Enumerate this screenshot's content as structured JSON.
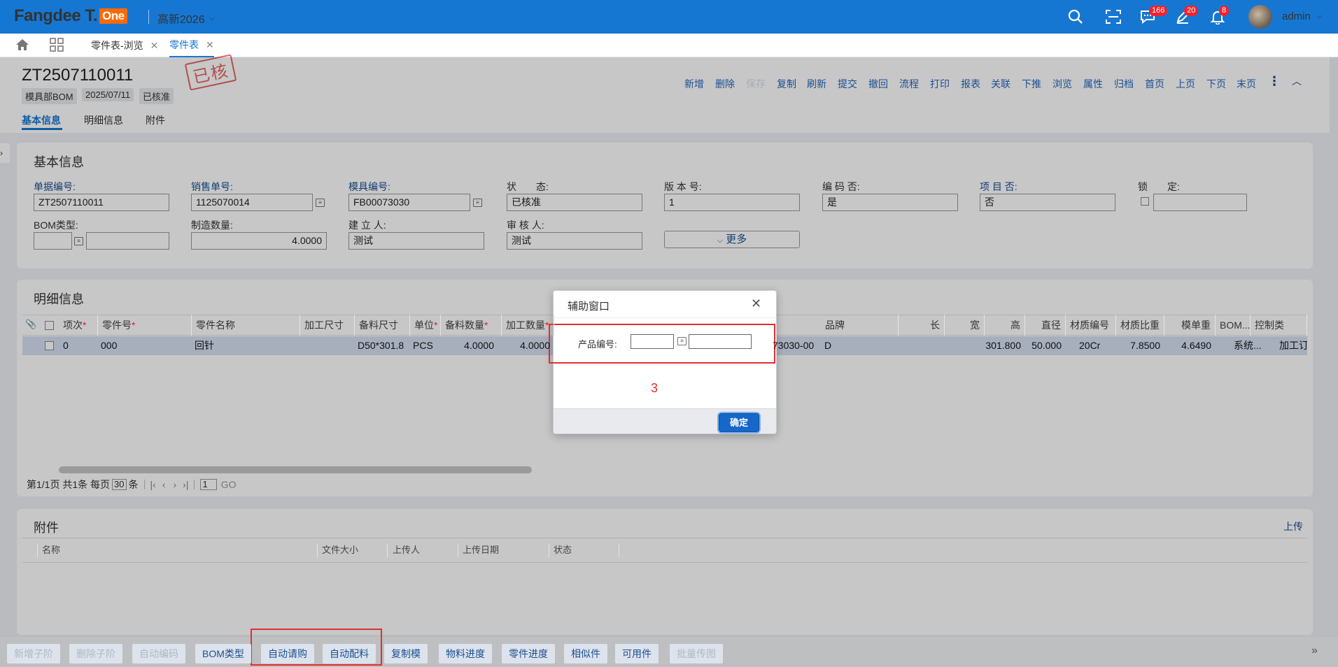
{
  "app": {
    "logo_text": "Fangdee T.",
    "logo_badge": "One",
    "company": "高新2026",
    "user": "admin",
    "badges": {
      "messages": "166",
      "edits": "20",
      "notifications": "8"
    }
  },
  "tabs": {
    "home_icon": "home-icon",
    "apps_icon": "apps-grid-icon",
    "items": [
      "零件表-浏览",
      "零件表"
    ]
  },
  "doc": {
    "number": "ZT2507110011",
    "tags": [
      "模具部BOM",
      "2025/07/11",
      "已核准"
    ],
    "stamp": "已核"
  },
  "actions": [
    "新增",
    "删除",
    "保存",
    "复制",
    "刷新",
    "提交",
    "撤回",
    "流程",
    "打印",
    "报表",
    "关联",
    "下推",
    "浏览",
    "属性",
    "归档",
    "首页",
    "上页",
    "下页",
    "末页"
  ],
  "subtabs": [
    "基本信息",
    "明细信息",
    "附件"
  ],
  "basic": {
    "title": "基本信息",
    "labels": {
      "doc_no": "单据编号:",
      "sales_no": "销售单号:",
      "mold_no": "模具编号:",
      "status": "状　　态:",
      "version": "版 本 号:",
      "coded": "编 码 否:",
      "project": "项 目 否:",
      "lock": "锁　　定:",
      "bom_type": "BOM类型:",
      "qty": "制造数量:",
      "creator": "建 立 人:",
      "approver": "审 核 人:"
    },
    "values": {
      "doc_no": "ZT2507110011",
      "sales_no": "1125070014",
      "mold_no": "FB00073030",
      "status": "已核准",
      "version": "1",
      "coded": "是",
      "project": "否",
      "lock": "",
      "bom_type": "",
      "bom_type_name": "",
      "qty": "4.0000",
      "creator": "测试",
      "approver": "测试"
    },
    "more": "更多"
  },
  "detail": {
    "title": "明细信息",
    "headers": [
      "项次",
      "零件号",
      "零件名称",
      "加工尺寸",
      "备料尺寸",
      "单位",
      "备料数量",
      "加工数量",
      "品牌",
      "长",
      "宽",
      "高",
      "直径",
      "材质编号",
      "材质比重",
      "模单重",
      "BOM...",
      "控制类"
    ],
    "row": {
      "idx": "0",
      "part_no": "000",
      "part_name": "回针",
      "proc_size": "",
      "stock_size": "D50*301.8",
      "unit": "PCS",
      "stock_qty": "4.0000",
      "proc_qty": "4.0000",
      "hidden_code": "73030-00",
      "brand": "D",
      "length": "",
      "width": "",
      "height": "301.800",
      "diameter": "50.000",
      "material": "20Cr",
      "density": "7.8500",
      "unit_weight": "4.6490",
      "bom": "系统...",
      "control": "加工订"
    },
    "pager": {
      "info": "第1/1页 共1条 每页",
      "per_page": "30",
      "unit": "条",
      "page": "1",
      "go": "GO"
    }
  },
  "attach": {
    "title": "附件",
    "upload": "上传",
    "headers": [
      "名称",
      "文件大小",
      "上传人",
      "上传日期",
      "状态"
    ]
  },
  "dialog": {
    "title": "辅助窗口",
    "label": "产品编号:",
    "code": "",
    "name": "",
    "note": "3",
    "ok": "确定"
  },
  "bottom": [
    {
      "label": "新增子阶",
      "enabled": false
    },
    {
      "label": "删除子阶",
      "enabled": false
    },
    {
      "label": "自动编码",
      "enabled": false
    },
    {
      "label": "BOM类型",
      "enabled": true
    },
    {
      "label": "自动请购",
      "enabled": true
    },
    {
      "label": "自动配料",
      "enabled": true
    },
    {
      "label": "复制模",
      "enabled": true
    },
    {
      "label": "物料进度",
      "enabled": true
    },
    {
      "label": "零件进度",
      "enabled": true
    },
    {
      "label": "相似件",
      "enabled": true
    },
    {
      "label": "可用件",
      "enabled": true
    },
    {
      "label": "批量传图",
      "enabled": false
    }
  ],
  "colors": {
    "brand": "#1677d2",
    "accent_orange": "#ff6a00",
    "highlight_red": "#e03030",
    "link_blue": "#1a4f93"
  }
}
